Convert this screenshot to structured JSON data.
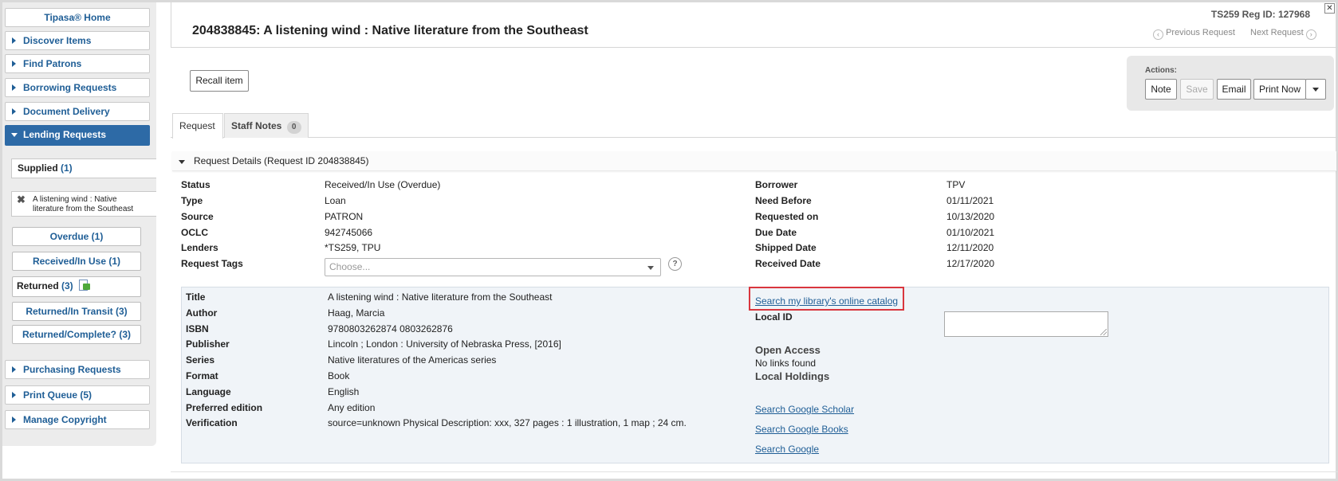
{
  "sidebar": {
    "home": "Tipasa® Home",
    "items": [
      {
        "label": "Discover Items"
      },
      {
        "label": "Find Patrons"
      },
      {
        "label": "Borrowing Requests"
      },
      {
        "label": "Document Delivery"
      },
      {
        "label": "Lending Requests"
      },
      {
        "label": "Purchasing Requests"
      },
      {
        "label": "Print Queue (5)"
      },
      {
        "label": "Manage Copyright"
      }
    ],
    "supplied_label": "Supplied",
    "supplied_count": "(1)",
    "open_item_line1": "A listening wind : Native",
    "open_item_line2": "literature from the Southeast",
    "statuses": [
      {
        "label": "Overdue (1)"
      },
      {
        "label": "Received/In Use (1)"
      },
      {
        "label": "Returned",
        "count": "(3)"
      },
      {
        "label": "Returned/In Transit (3)"
      },
      {
        "label": "Returned/Complete? (3)"
      }
    ]
  },
  "header": {
    "title": "204838845: A listening wind : Native literature from the Southeast",
    "reg_id": "TS259 Reg ID: 127968",
    "previous": "Previous Request",
    "next": "Next Request"
  },
  "toolbar": {
    "recall": "Recall item",
    "actions_label": "Actions:",
    "note": "Note",
    "save": "Save",
    "email": "Email",
    "print_now": "Print Now"
  },
  "tabs": {
    "request": "Request",
    "staff_notes": "Staff Notes",
    "staff_notes_count": "0"
  },
  "details": {
    "heading": "Request Details (Request ID 204838845)",
    "left": [
      {
        "label": "Status",
        "value": "Received/In Use (Overdue)"
      },
      {
        "label": "Type",
        "value": "Loan"
      },
      {
        "label": "Source",
        "value": "PATRON"
      },
      {
        "label": "OCLC",
        "value": "942745066"
      },
      {
        "label": "Lenders",
        "value": "*TS259, TPU"
      },
      {
        "label": "Request Tags",
        "value": ""
      }
    ],
    "right": [
      {
        "label": "Borrower",
        "value": "TPV"
      },
      {
        "label": "Need Before",
        "value": "01/11/2021"
      },
      {
        "label": "Requested on",
        "value": "10/13/2020"
      },
      {
        "label": "Due Date",
        "value": "01/10/2021"
      },
      {
        "label": "Shipped Date",
        "value": "12/11/2020"
      },
      {
        "label": "Received Date",
        "value": "12/17/2020"
      }
    ],
    "tags_placeholder": "Choose..."
  },
  "biblio": {
    "rows": [
      {
        "label": "Title",
        "value": "A listening wind : Native literature from the Southeast"
      },
      {
        "label": "Author",
        "value": "Haag, Marcia"
      },
      {
        "label": "ISBN",
        "value": "9780803262874 0803262876"
      },
      {
        "label": "Publisher",
        "value": "Lincoln ; London : University of Nebraska Press, [2016]"
      },
      {
        "label": "Series",
        "value": "Native literatures of the Americas series"
      },
      {
        "label": "Format",
        "value": "Book"
      },
      {
        "label": "Language",
        "value": "English"
      },
      {
        "label": "Preferred edition",
        "value": "Any edition"
      },
      {
        "label": "Verification",
        "value": "source=unknown Physical Description: xxx, 327 pages : 1 illustration, 1 map ; 24 cm."
      }
    ],
    "catalog_link": "Search my library's online catalog",
    "local_id_label": "Local ID",
    "open_access": "Open Access",
    "no_links": "No links found",
    "local_holdings": "Local Holdings",
    "search_scholar": "Search Google Scholar",
    "search_books": "Search Google Books",
    "search_google": "Search Google"
  },
  "colors": {
    "accent": "#1f5e96",
    "active_nav": "#2d6aa6",
    "highlight": "#d9363e"
  }
}
